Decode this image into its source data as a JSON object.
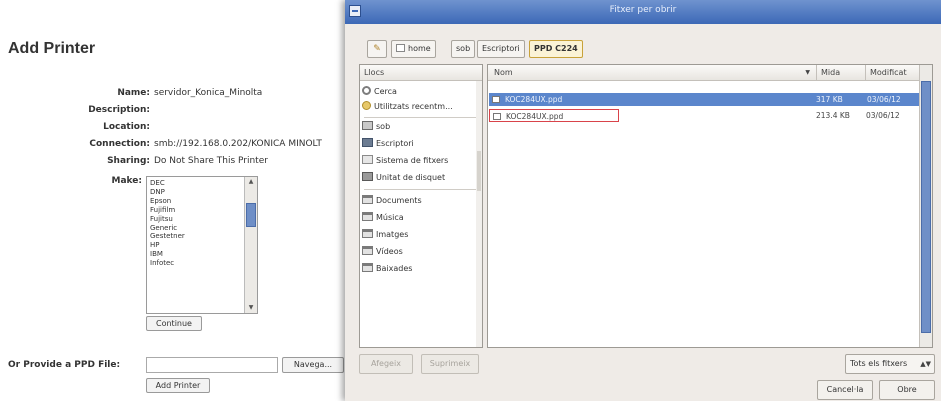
{
  "page": {
    "title": "Add Printer",
    "fields": [
      {
        "label": "Name:",
        "value": "servidor_Konica_Minolta"
      },
      {
        "label": "Description:",
        "value": ""
      },
      {
        "label": "Location:",
        "value": ""
      },
      {
        "label": "Connection:",
        "value": "smb://192.168.0.202/KONICA MINOLT"
      },
      {
        "label": "Sharing:",
        "value": "Do Not Share This Printer"
      }
    ],
    "make_label": "Make:",
    "make_list": [
      "DEC",
      "DNP",
      "Epson",
      "Fujifilm",
      "Fujitsu",
      "Generic",
      "Gestetner",
      "HP",
      "IBM",
      "Infotec"
    ],
    "continue_button": "Continue",
    "ppd_label": "Or Provide a PPD File:",
    "browse_button": "Navega...",
    "add_printer_button": "Add Printer"
  },
  "dialog": {
    "title": "Fitxer per obrir",
    "pathbar": [
      "home",
      "sob",
      "Escriptori",
      "PPD C224"
    ],
    "places_header": "Llocs",
    "places": [
      {
        "label": "Cerca",
        "icon": "search-icon"
      },
      {
        "label": "Utilitzats recentm...",
        "icon": "recent-icon"
      },
      {
        "label": "sob",
        "icon": "home-folder-icon"
      },
      {
        "label": "Escriptori",
        "icon": "desktop-icon"
      },
      {
        "label": "Sistema de fitxers",
        "icon": "filesystem-icon"
      },
      {
        "label": "Unitat de disquet",
        "icon": "floppy-icon"
      },
      {
        "label": "Documents",
        "icon": "folder-icon"
      },
      {
        "label": "Música",
        "icon": "folder-icon"
      },
      {
        "label": "Imatges",
        "icon": "folder-icon"
      },
      {
        "label": "Vídeos",
        "icon": "folder-icon"
      },
      {
        "label": "Baixades",
        "icon": "folder-icon"
      }
    ],
    "columns": {
      "name": "Nom",
      "size": "Mida",
      "modified": "Modificat"
    },
    "files": [
      {
        "name": "KOC284UX.ppd",
        "size": "317 KB",
        "modified": "03/06/12"
      },
      {
        "name": "KOC284UX.ppd",
        "size": "213.4 KB",
        "modified": "03/06/12"
      }
    ],
    "add_button": "Afegeix",
    "remove_button": "Suprimeix",
    "filter": "Tots els fitxers",
    "cancel_button": "Cancel·la",
    "open_button": "Obre"
  },
  "colors": {
    "selection": "#5b86cc",
    "titlebar": "#3c68b6",
    "focus_outline": "#d9434a",
    "dialog_bg": "#efebe7"
  }
}
